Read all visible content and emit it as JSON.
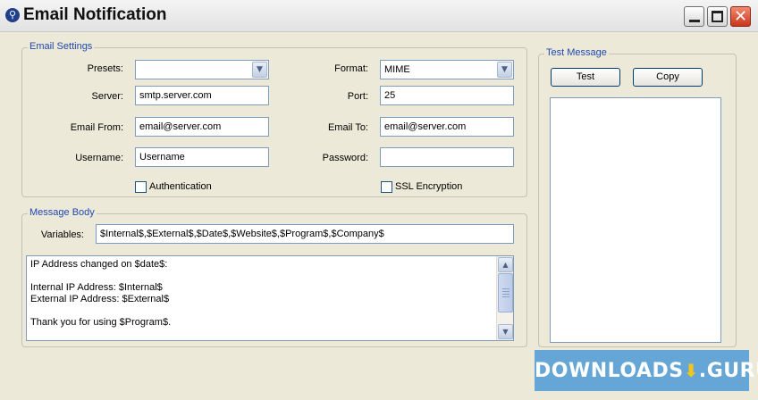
{
  "window": {
    "title": "Email Notification",
    "app_icon_glyph": "⚲",
    "controls": {
      "minimize": "minimize-icon",
      "maximize": "maximize-icon",
      "close": "✕"
    }
  },
  "email_settings": {
    "group_label": "Email Settings",
    "presets": {
      "label": "Presets:",
      "value": ""
    },
    "server": {
      "label": "Server:",
      "value": "smtp.server.com"
    },
    "email_from": {
      "label": "Email From:",
      "value": "email@server.com"
    },
    "username": {
      "label": "Username:",
      "value": "Username"
    },
    "authentication": {
      "label": "Authentication",
      "checked": false
    },
    "format": {
      "label": "Format:",
      "value": "MIME"
    },
    "port": {
      "label": "Port:",
      "value": "25"
    },
    "email_to": {
      "label": "Email To:",
      "value": "email@server.com"
    },
    "password": {
      "label": "Password:",
      "value": ""
    },
    "ssl": {
      "label": "SSL Encryption",
      "checked": false
    }
  },
  "message_body": {
    "group_label": "Message Body",
    "variables": {
      "label": "Variables:",
      "value": "$Internal$,$External$,$Date$,$Website$,$Program$,$Company$"
    },
    "body_text": "IP Address changed on $date$:\n\nInternal IP Address: $Internal$\nExternal IP Address: $External$\n\nThank you for using $Program$."
  },
  "test_message": {
    "group_label": "Test Message",
    "test_button": "Test",
    "copy_button": "Copy",
    "output": ""
  },
  "watermark": {
    "text_left": "DOWNLOADS",
    "arrow": "⬇",
    "text_right": ".GURU"
  },
  "colors": {
    "window_bg": "#ece9d8",
    "group_label": "#1f48b0",
    "field_border": "#7f9db9",
    "close_button": "#c8361b",
    "watermark_bg": "#529cd6"
  }
}
